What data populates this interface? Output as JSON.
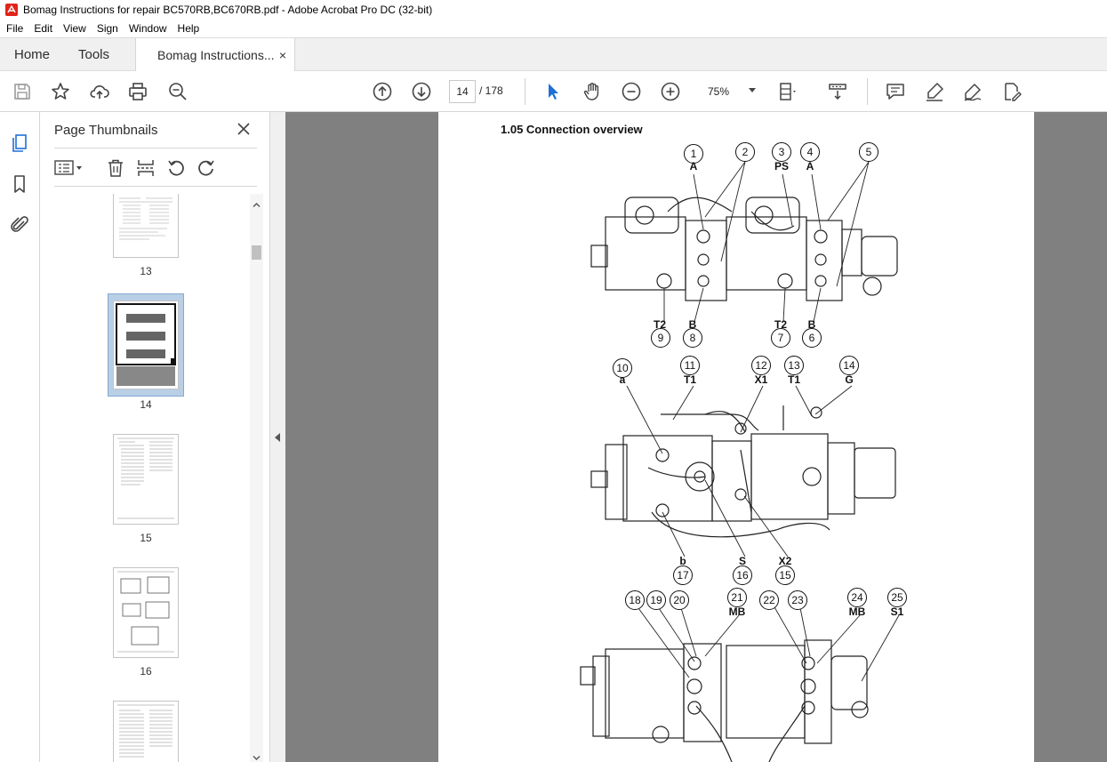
{
  "window": {
    "title": "Bomag Instructions for repair BC570RB,BC670RB.pdf - Adobe Acrobat Pro DC (32-bit)",
    "icon": "acrobat-icon",
    "accent": "#e2231a"
  },
  "menu": [
    "File",
    "Edit",
    "View",
    "Sign",
    "Window",
    "Help"
  ],
  "tabs": {
    "home": "Home",
    "tools": "Tools",
    "doc": "Bomag Instructions...",
    "close": "×"
  },
  "toolbar": {
    "page_current": "14",
    "page_total": "/ 178",
    "zoom": "75%",
    "icons": [
      "save-icon",
      "bookmark-star-icon",
      "upload-icon",
      "print-icon",
      "zoom-search-icon",
      "prev-page-icon",
      "next-page-icon",
      "select-cursor-icon",
      "hand-icon",
      "zoom-out-icon",
      "zoom-in-icon",
      "page-fit-icon",
      "scroll-mode-icon",
      "comment-icon",
      "highlight-icon",
      "sign-icon",
      "edit-pdf-icon"
    ]
  },
  "rail": [
    "thumbnails-icon",
    "bookmarks-icon",
    "attachments-icon"
  ],
  "panel": {
    "title": "Page Thumbnails",
    "close": "×",
    "tools": [
      "options-menu-icon",
      "delete-icon",
      "insert-page-icon",
      "rotate-left-icon",
      "rotate-right-icon"
    ],
    "thumbnails": [
      {
        "label": "13",
        "selected": false
      },
      {
        "label": "14",
        "selected": true
      },
      {
        "label": "15",
        "selected": false
      },
      {
        "label": "16",
        "selected": false
      },
      {
        "label": "",
        "selected": false
      }
    ]
  },
  "document": {
    "heading": "1.05  Connection overview",
    "callouts_top": [
      {
        "num": "1",
        "label": "A"
      },
      {
        "num": "2",
        "label": ""
      },
      {
        "num": "3",
        "label": "PS"
      },
      {
        "num": "4",
        "label": "A"
      },
      {
        "num": "5",
        "label": ""
      }
    ],
    "callouts_top_bottom": [
      {
        "num": "9",
        "label": "T2"
      },
      {
        "num": "8",
        "label": "B"
      },
      {
        "num": "7",
        "label": "T2"
      },
      {
        "num": "6",
        "label": "B"
      }
    ],
    "callouts_mid": [
      {
        "num": "10",
        "label": "a"
      },
      {
        "num": "11",
        "label": "T1"
      },
      {
        "num": "12",
        "label": "X1"
      },
      {
        "num": "13",
        "label": "T1"
      },
      {
        "num": "14",
        "label": "G"
      }
    ],
    "callouts_mid_bottom": [
      {
        "num": "17",
        "label": "b"
      },
      {
        "num": "16",
        "label": "S"
      },
      {
        "num": "15",
        "label": "X2"
      }
    ],
    "callouts_low": [
      {
        "num": "18",
        "label": ""
      },
      {
        "num": "19",
        "label": ""
      },
      {
        "num": "20",
        "label": ""
      },
      {
        "num": "21",
        "label": "MB"
      },
      {
        "num": "22",
        "label": ""
      },
      {
        "num": "23",
        "label": ""
      },
      {
        "num": "24",
        "label": "MB"
      },
      {
        "num": "25",
        "label": "S1"
      }
    ]
  }
}
